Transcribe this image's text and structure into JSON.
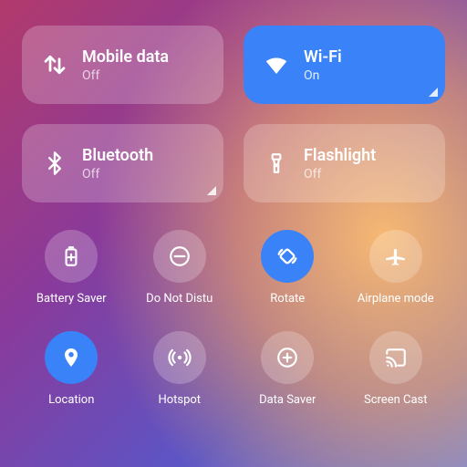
{
  "colors": {
    "accent": "#3a82f7",
    "tile_off_bg": "rgba(255,255,255,0.22)"
  },
  "tiles": [
    {
      "id": "mobile-data",
      "icon": "data-arrows-icon",
      "title": "Mobile data",
      "status": "Off",
      "on": false,
      "expandable": false
    },
    {
      "id": "wifi",
      "icon": "wifi-icon",
      "title": "Wi-Fi",
      "status": "On",
      "on": true,
      "expandable": true
    },
    {
      "id": "bluetooth",
      "icon": "bluetooth-icon",
      "title": "Bluetooth",
      "status": "Off",
      "on": false,
      "expandable": true
    },
    {
      "id": "flashlight",
      "icon": "flashlight-icon",
      "title": "Flashlight",
      "status": "Off",
      "on": false,
      "expandable": false
    }
  ],
  "quick": [
    {
      "id": "battery-saver",
      "icon": "battery-plus-icon",
      "label": "Battery Saver",
      "on": false
    },
    {
      "id": "dnd",
      "icon": "dnd-icon",
      "label": "Do Not Distu",
      "on": false
    },
    {
      "id": "rotate",
      "icon": "rotate-icon",
      "label": "Rotate",
      "on": true
    },
    {
      "id": "airplane",
      "icon": "airplane-icon",
      "label": "Airplane mode",
      "on": false
    },
    {
      "id": "location",
      "icon": "location-icon",
      "label": "Location",
      "on": true
    },
    {
      "id": "hotspot",
      "icon": "hotspot-icon",
      "label": "Hotspot",
      "on": false
    },
    {
      "id": "data-saver",
      "icon": "data-saver-icon",
      "label": "Data Saver",
      "on": false
    },
    {
      "id": "screen-cast",
      "icon": "cast-icon",
      "label": "Screen Cast",
      "on": false
    }
  ]
}
